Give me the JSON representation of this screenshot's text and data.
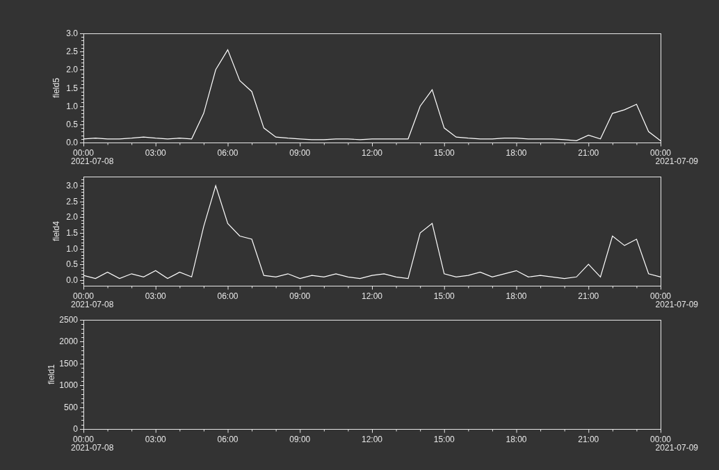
{
  "charts": [
    {
      "start_date": "2021-07-08",
      "end_date": "2021-07-09",
      "chart_data": {
        "type": "line",
        "ylabel": "field5",
        "xlim": [
          0,
          24
        ],
        "ylim": [
          0,
          3
        ],
        "xticks": [
          {
            "value": 0,
            "label": "00:00"
          },
          {
            "value": 3,
            "label": "03:00"
          },
          {
            "value": 6,
            "label": "06:00"
          },
          {
            "value": 9,
            "label": "09:00"
          },
          {
            "value": 12,
            "label": "12:00"
          },
          {
            "value": 15,
            "label": "15:00"
          },
          {
            "value": 18,
            "label": "18:00"
          },
          {
            "value": 21,
            "label": "21:00"
          },
          {
            "value": 24,
            "label": "00:00"
          }
        ],
        "yticks": [
          {
            "value": 0,
            "label": "0.0"
          },
          {
            "value": 0.5,
            "label": "0.5"
          },
          {
            "value": 1,
            "label": "1.0"
          },
          {
            "value": 1.5,
            "label": "1.5"
          },
          {
            "value": 2,
            "label": "2.0"
          },
          {
            "value": 2.5,
            "label": "2.5"
          },
          {
            "value": 3,
            "label": "3.0"
          }
        ],
        "x": [
          0,
          0.5,
          1,
          1.5,
          2,
          2.5,
          3,
          3.5,
          4,
          4.5,
          5,
          5.5,
          6,
          6.5,
          7,
          7.5,
          8,
          8.5,
          9,
          9.5,
          10,
          10.5,
          11,
          11.5,
          12,
          12.5,
          13,
          13.5,
          14,
          14.5,
          15,
          15.5,
          16,
          16.5,
          17,
          17.5,
          18,
          18.5,
          19,
          19.5,
          20,
          20.5,
          21,
          21.5,
          22,
          22.5,
          23,
          23.5,
          24
        ],
        "series": [
          {
            "color": "#ffffff",
            "values": [
              0.1,
              0.12,
              0.1,
              0.1,
              0.12,
              0.15,
              0.12,
              0.1,
              0.12,
              0.1,
              0.8,
              2.0,
              2.55,
              1.7,
              1.4,
              0.4,
              0.15,
              0.12,
              0.1,
              0.08,
              0.08,
              0.1,
              0.1,
              0.08,
              0.1,
              0.1,
              0.1,
              0.1,
              1.0,
              1.45,
              0.4,
              0.15,
              0.12,
              0.1,
              0.1,
              0.12,
              0.12,
              0.1,
              0.1,
              0.1,
              0.08,
              0.05,
              0.2,
              0.1,
              0.8,
              0.9,
              1.05,
              0.3,
              0.05
            ]
          }
        ]
      }
    },
    {
      "start_date": "2021-07-08",
      "end_date": "2021-07-09",
      "chart_data": {
        "type": "line",
        "ylabel": "field4",
        "xlim": [
          0,
          24
        ],
        "ylim": [
          -0.18,
          3.29
        ],
        "xticks": [
          {
            "value": 0,
            "label": "00:00"
          },
          {
            "value": 3,
            "label": "03:00"
          },
          {
            "value": 6,
            "label": "06:00"
          },
          {
            "value": 9,
            "label": "09:00"
          },
          {
            "value": 12,
            "label": "12:00"
          },
          {
            "value": 15,
            "label": "15:00"
          },
          {
            "value": 18,
            "label": "18:00"
          },
          {
            "value": 21,
            "label": "21:00"
          },
          {
            "value": 24,
            "label": "00:00"
          }
        ],
        "yticks": [
          {
            "value": 0,
            "label": "0.0"
          },
          {
            "value": 0.5,
            "label": "0.5"
          },
          {
            "value": 1,
            "label": "1.0"
          },
          {
            "value": 1.5,
            "label": "1.5"
          },
          {
            "value": 2,
            "label": "2.0"
          },
          {
            "value": 2.5,
            "label": "2.5"
          },
          {
            "value": 3,
            "label": "3.0"
          }
        ],
        "x": [
          0,
          0.5,
          1,
          1.5,
          2,
          2.5,
          3,
          3.5,
          4,
          4.5,
          5,
          5.5,
          6,
          6.5,
          7,
          7.5,
          8,
          8.5,
          9,
          9.5,
          10,
          10.5,
          11,
          11.5,
          12,
          12.5,
          13,
          13.5,
          14,
          14.5,
          15,
          15.5,
          16,
          16.5,
          17,
          17.5,
          18,
          18.5,
          19,
          19.5,
          20,
          20.5,
          21,
          21.5,
          22,
          22.5,
          23,
          23.5,
          24
        ],
        "series": [
          {
            "color": "#ffffff",
            "values": [
              0.15,
              0.05,
              0.25,
              0.05,
              0.2,
              0.1,
              0.3,
              0.05,
              0.25,
              0.1,
              1.7,
              3.0,
              1.8,
              1.4,
              1.3,
              0.15,
              0.1,
              0.2,
              0.05,
              0.15,
              0.1,
              0.2,
              0.1,
              0.05,
              0.15,
              0.2,
              0.1,
              0.05,
              1.5,
              1.8,
              0.2,
              0.1,
              0.15,
              0.25,
              0.1,
              0.2,
              0.3,
              0.1,
              0.15,
              0.1,
              0.05,
              0.1,
              0.5,
              0.1,
              1.4,
              1.1,
              1.3,
              0.2,
              0.1
            ]
          }
        ]
      }
    },
    {
      "start_date": "2021-07-08",
      "end_date": "2021-07-09",
      "chart_data": {
        "type": "line",
        "ylabel": "field1",
        "xlim": [
          0,
          24
        ],
        "ylim": [
          0,
          2500
        ],
        "xticks": [
          {
            "value": 0,
            "label": "00:00"
          },
          {
            "value": 3,
            "label": "03:00"
          },
          {
            "value": 6,
            "label": "06:00"
          },
          {
            "value": 9,
            "label": "09:00"
          },
          {
            "value": 12,
            "label": "12:00"
          },
          {
            "value": 15,
            "label": "15:00"
          },
          {
            "value": 18,
            "label": "18:00"
          },
          {
            "value": 21,
            "label": "21:00"
          },
          {
            "value": 24,
            "label": "00:00"
          }
        ],
        "yticks": [
          0,
          500,
          1000,
          1500,
          2000,
          2500
        ]
      }
    }
  ]
}
